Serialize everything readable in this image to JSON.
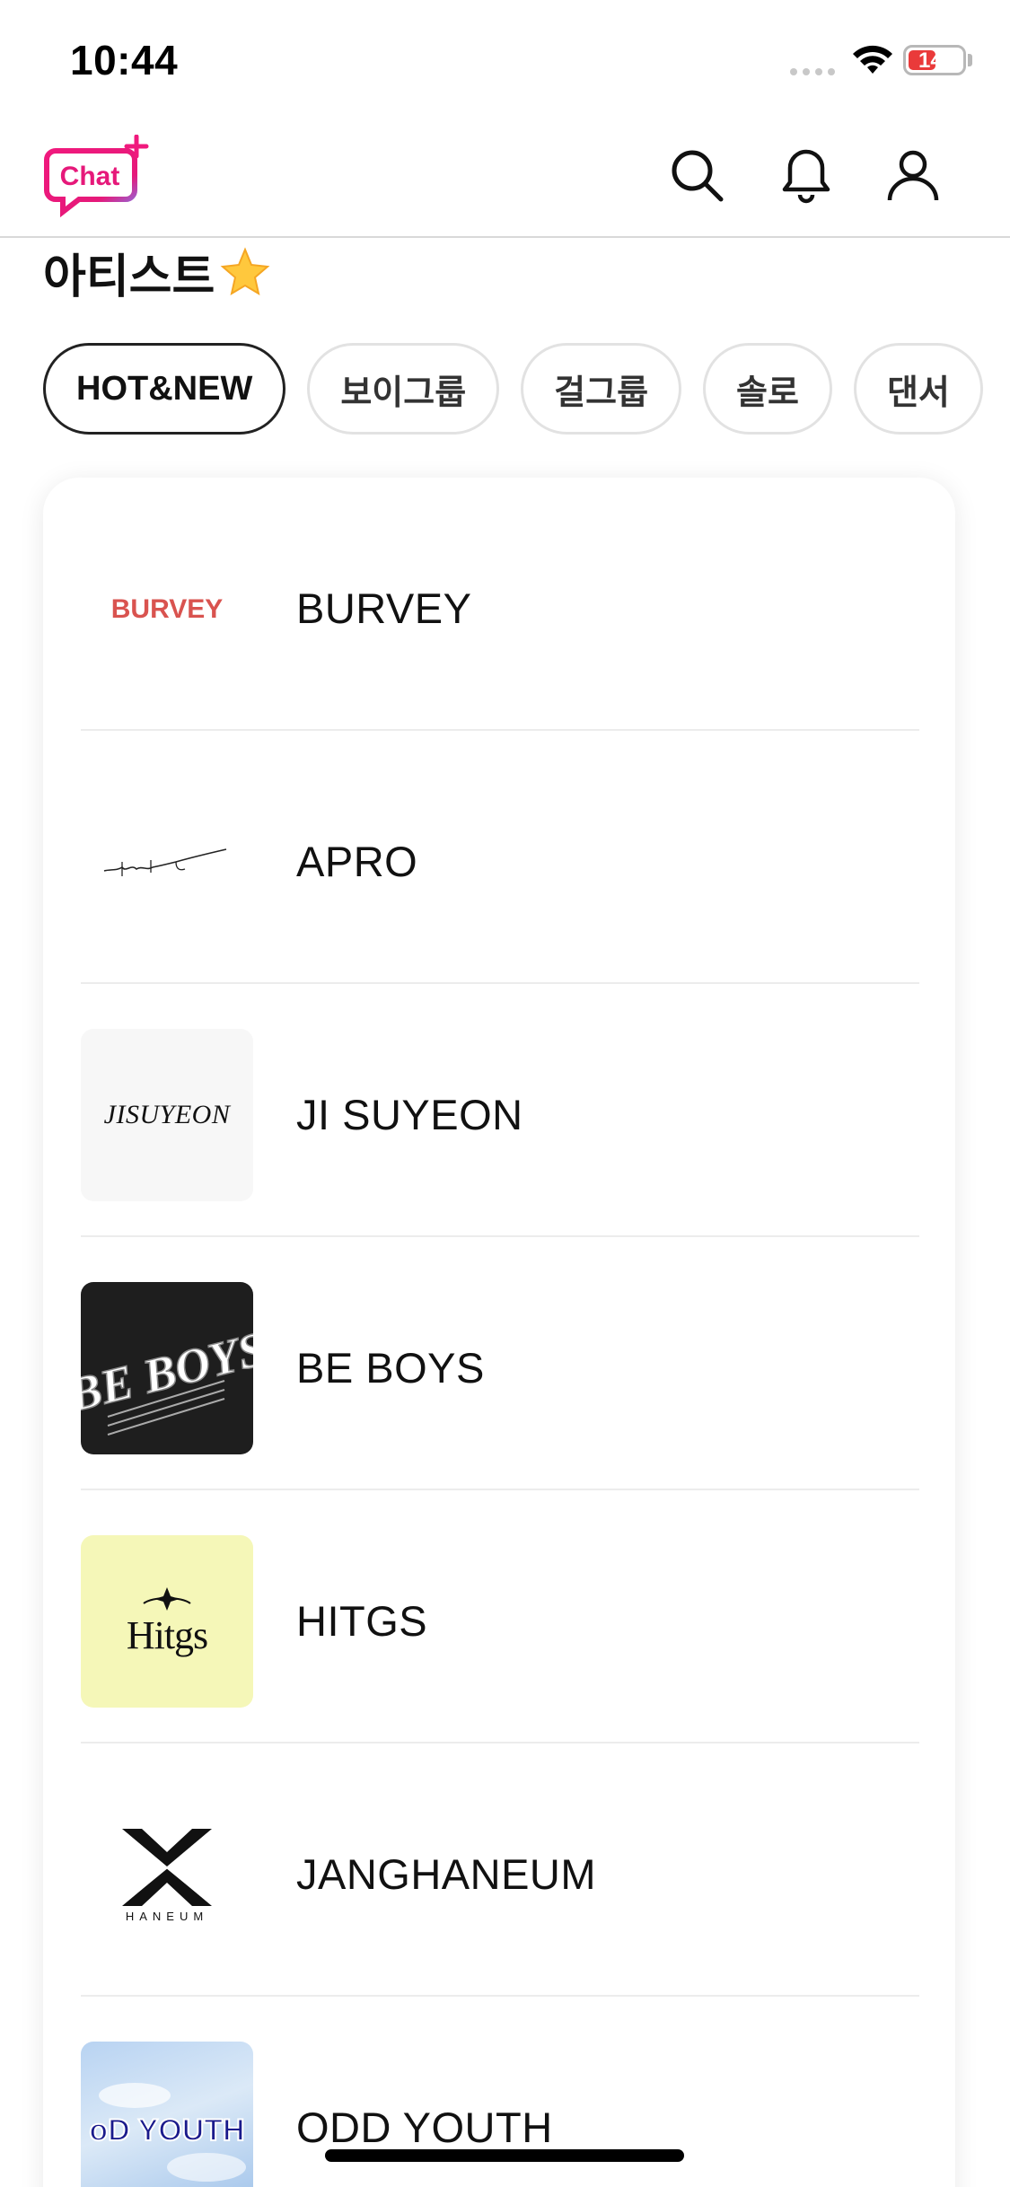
{
  "status_bar": {
    "time": "10:44",
    "battery": "14"
  },
  "header": {
    "logo_text": "Chat",
    "icons": [
      "search-icon",
      "bell-icon",
      "user-icon"
    ]
  },
  "section": {
    "title": "아티스트",
    "title_emoji": "star-icon"
  },
  "filters": [
    {
      "label": "HOT&NEW",
      "active": true
    },
    {
      "label": "보이그룹",
      "active": false
    },
    {
      "label": "걸그룹",
      "active": false
    },
    {
      "label": "솔로",
      "active": false
    },
    {
      "label": "댄서",
      "active": false
    }
  ],
  "artists": [
    {
      "name": "BURVEY",
      "logo_text": "BURVEY"
    },
    {
      "name": "APRO",
      "logo_text": ""
    },
    {
      "name": "JI SUYEON",
      "logo_text": "JISUYEON"
    },
    {
      "name": "BE BOYS",
      "logo_text": "BE BOYS"
    },
    {
      "name": "HITGS",
      "logo_text": "Hitgs"
    },
    {
      "name": "JANGHANEUM",
      "logo_text": "HANEUM"
    },
    {
      "name": "ODD YOUTH",
      "logo_text": "oD YOUTH"
    }
  ],
  "colors": {
    "logo_pink": "#e6197a",
    "accent": "#ea3a3a",
    "hitgs_bg": "#f5f7b8",
    "beboys_bg": "#1e1e1e"
  }
}
